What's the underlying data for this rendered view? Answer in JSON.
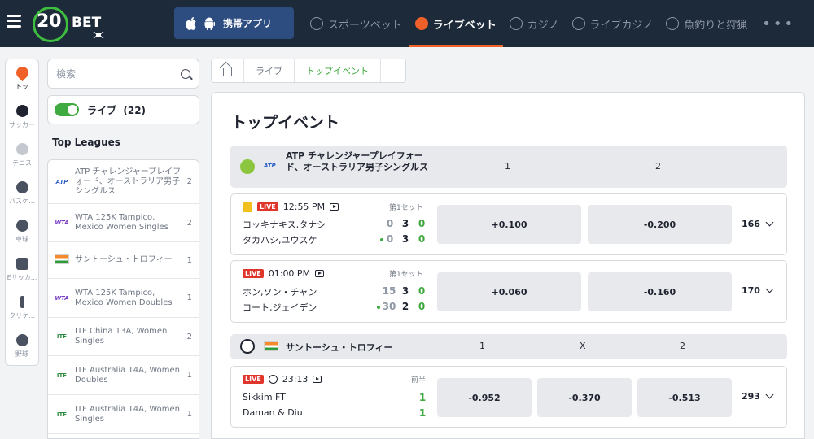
{
  "header": {
    "logo_number": "20",
    "logo_text": "BET",
    "app_button_label": "携帯アプリ",
    "nav": [
      {
        "label": "スポーツベット",
        "icon": "soccer-ball-icon",
        "active": false
      },
      {
        "label": "ライブベット",
        "icon": "live-stopwatch-icon",
        "active": true
      },
      {
        "label": "カジノ",
        "icon": "casino-chip-icon",
        "active": false
      },
      {
        "label": "ライブカジノ",
        "icon": "cards-icon",
        "active": false
      },
      {
        "label": "魚釣りと狩猟",
        "icon": "target-icon",
        "active": false
      }
    ],
    "more_label": "•••",
    "accent_color": "#f0612a"
  },
  "rail": [
    {
      "label": "トッ",
      "icon": "fire-icon",
      "active": true
    },
    {
      "label": "サッカー",
      "icon": "soccer-icon"
    },
    {
      "label": "テニス",
      "icon": "tennis-icon"
    },
    {
      "label": "バスケ...",
      "icon": "basketball-icon"
    },
    {
      "label": "卓球",
      "icon": "table-tennis-icon"
    },
    {
      "label": "Eサッカ...",
      "icon": "esoccer-icon"
    },
    {
      "label": "クリケ...",
      "icon": "cricket-icon"
    },
    {
      "label": "野球",
      "icon": "baseball-icon"
    }
  ],
  "sidebar": {
    "search_placeholder": "検索",
    "live_label": "ライブ",
    "live_count": "(22)",
    "top_leagues_title": "Top Leagues",
    "leagues": [
      {
        "icon": "ATP",
        "name": "ATP チャレンジャープレイフォード、オーストラリア男子シングルス",
        "count": "2"
      },
      {
        "icon": "WTA",
        "name": "WTA 125K Tampico, Mexico Women Singles",
        "count": "2"
      },
      {
        "icon": "flag-india",
        "name": "サントーシュ・トロフィー",
        "count": "1"
      },
      {
        "icon": "WTA",
        "name": "WTA 125K Tampico, Mexico Women Doubles",
        "count": "1"
      },
      {
        "icon": "ITF",
        "name": "ITF China 13A, Women Singles",
        "count": "2"
      },
      {
        "icon": "ITF",
        "name": "ITF Australia 14A, Women Doubles",
        "count": "1"
      },
      {
        "icon": "ITF",
        "name": "ITF Australia 14A, Women Singles",
        "count": "1"
      }
    ]
  },
  "breadcrumb": {
    "items": [
      "ライブ",
      "トップイベント"
    ]
  },
  "main": {
    "title": "トップイベント",
    "groups": [
      {
        "league": "ATP チャレンジャープレイフォード、オーストラリア男子シングルス",
        "badge": "ATP",
        "col1": "1",
        "col2": "2",
        "events": [
          {
            "time": "12:55 PM",
            "period": "第1セット",
            "team1": "コッキナキス,タナシ",
            "team2": "タカハシ,ユウスケ",
            "t1_scores": [
              "0",
              "3",
              "0"
            ],
            "t2_scores": [
              "0",
              "3",
              "0"
            ],
            "odd1": "+0.100",
            "odd2": "-0.200",
            "more": "166"
          },
          {
            "time": "01:00 PM",
            "period": "第1セット",
            "team1": "ホン,ソン・チャン",
            "team2": "コート,ジェイデン",
            "t1_scores": [
              "15",
              "3",
              "0"
            ],
            "t2_scores": [
              "30",
              "2",
              "0"
            ],
            "odd1": "+0.060",
            "odd2": "-0.160",
            "more": "170"
          }
        ]
      },
      {
        "league": "サントーシュ・トロフィー",
        "col1": "1",
        "colx": "X",
        "col2": "2",
        "events": [
          {
            "time": "23:13",
            "period": "前半",
            "team1": "Sikkim FT",
            "team2": "Daman & Diu",
            "t1_score": "1",
            "t2_score": "1",
            "odd1": "-0.952",
            "oddx": "-0.370",
            "odd2": "-0.513",
            "more": "293"
          }
        ]
      }
    ]
  },
  "live_label": "LIVE"
}
